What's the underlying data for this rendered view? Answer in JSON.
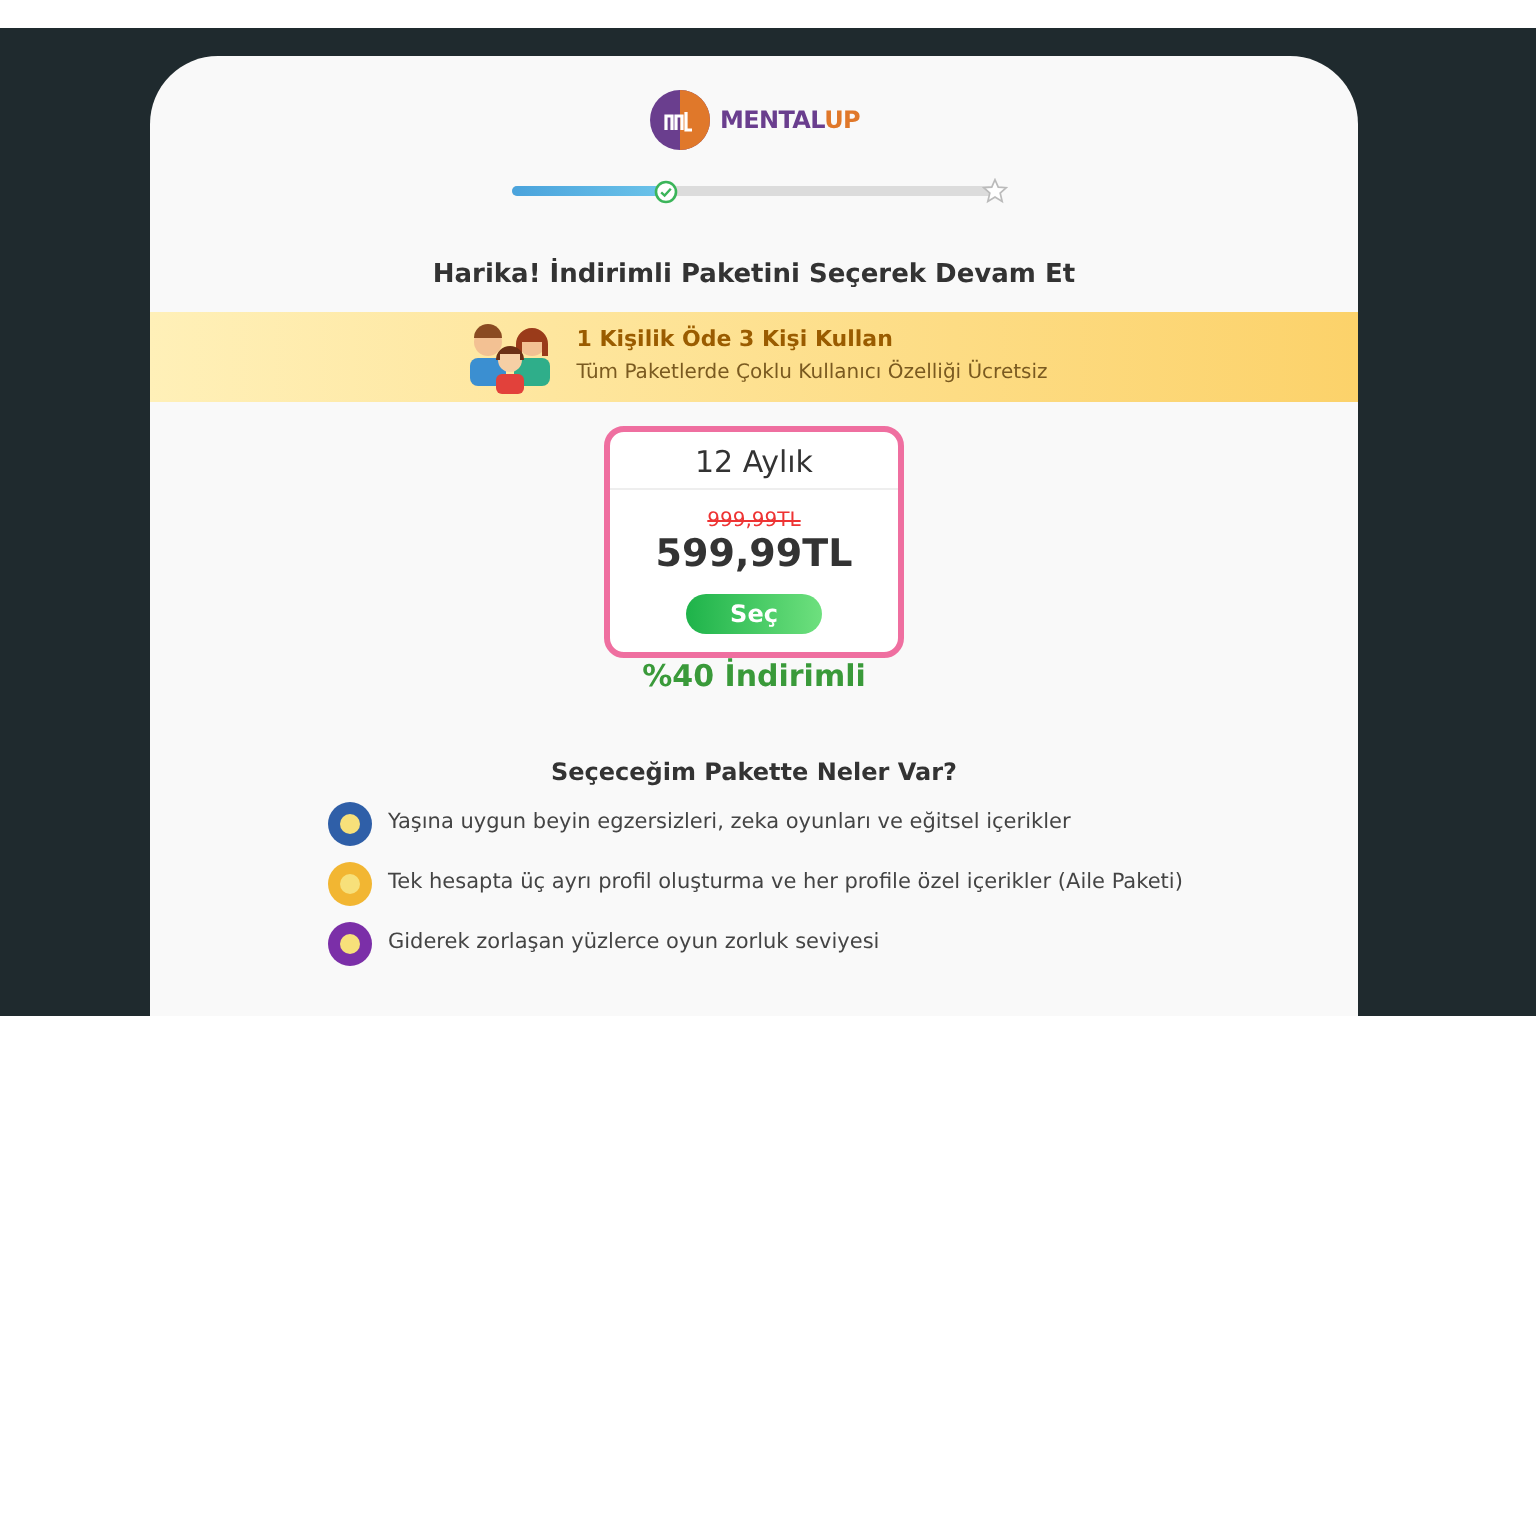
{
  "logo": {
    "first": "MENTAL",
    "second": "UP"
  },
  "progress": {
    "level": 0.32
  },
  "heading": "Harika! İndirimli Paketini Seçerek Devam Et",
  "banner": {
    "title": "1 Kişilik Öde 3 Kişi Kullan",
    "subtitle": "Tüm Paketlerde Çoklu Kullanıcı Özelliği Ücretsiz"
  },
  "plan": {
    "name": "12 Aylık",
    "old_price": "999,99TL",
    "price": "599,99TL",
    "button": "Seç",
    "selected": true,
    "discount": "%40 İndirimli"
  },
  "features_title": "Seçeceğim Pakette Neler Var?",
  "features": [
    {
      "text": "Yaşına uygun beyin egzersizleri, zeka oyunları ve eğitsel içerikler",
      "color": "#2f5fa8"
    },
    {
      "text": "Tek hesapta üç ayrı profil oluşturma ve her profile özel içerikler (Aile Paketi)",
      "color": "#f2b632"
    },
    {
      "text": "Giderek zorlaşan yüzlerce oyun zorluk seviyesi",
      "color": "#7b2fa8"
    }
  ]
}
